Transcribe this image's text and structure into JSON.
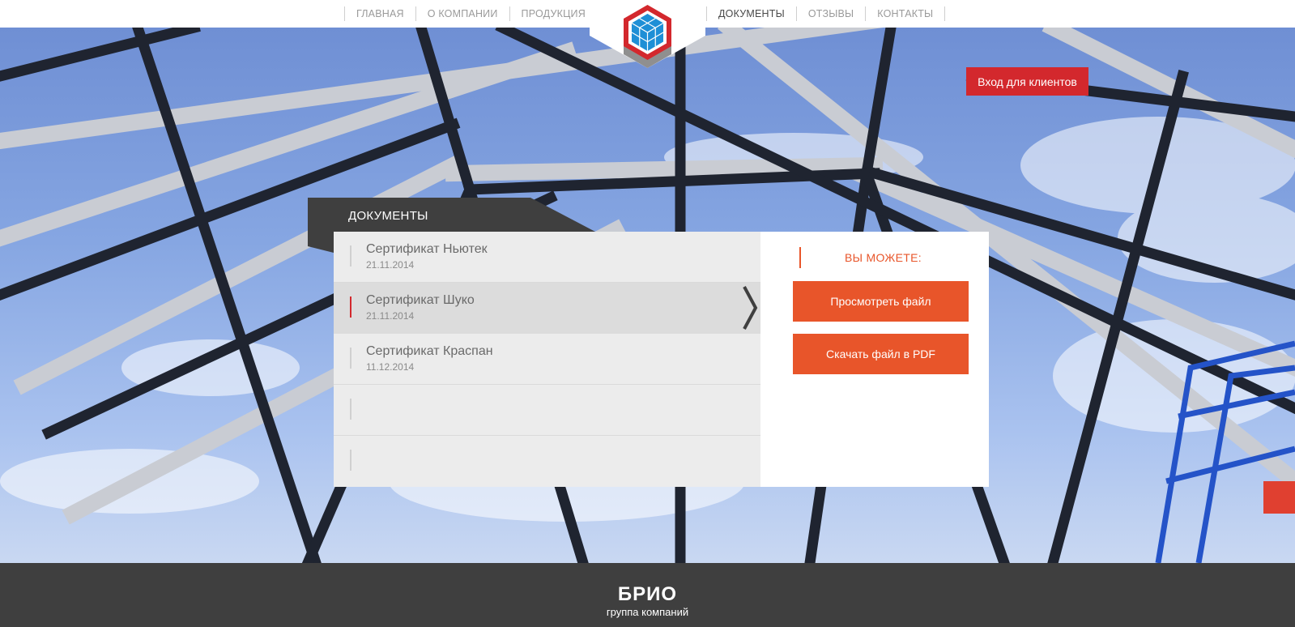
{
  "nav": {
    "left": [
      {
        "label": "ГЛАВНАЯ",
        "active": false
      },
      {
        "label": "О КОМПАНИИ",
        "active": false
      },
      {
        "label": "ПРОДУКЦИЯ",
        "active": false
      }
    ],
    "right": [
      {
        "label": "ДОКУМЕНТЫ",
        "active": true
      },
      {
        "label": "ОТЗЫВЫ",
        "active": false
      },
      {
        "label": "КОНТАКТЫ",
        "active": false
      }
    ]
  },
  "header": {
    "logo_icon": "hexagon-cube-logo-icon",
    "client_login_label": "Вход для клиентов"
  },
  "documents": {
    "tab_title": "ДОКУМЕНТЫ",
    "items": [
      {
        "name": "Сертификат Ньютек",
        "date": "21.11.2014"
      },
      {
        "name": "Сертификат Шуко",
        "date": "21.11.2014"
      },
      {
        "name": "Сертификат Краспан",
        "date": "11.12.2014"
      },
      {
        "name": "",
        "date": ""
      },
      {
        "name": "",
        "date": ""
      }
    ],
    "selected_index": 1
  },
  "actions": {
    "heading": "ВЫ МОЖЕТЕ:",
    "view_label": "Просмотреть файл",
    "download_label": "Скачать файл в PDF"
  },
  "footer": {
    "brand": "БРИО",
    "subtitle": "группа компаний"
  },
  "colors": {
    "accent_red": "#d3282d",
    "accent_orange": "#e8552a",
    "dark_grey": "#3f3f3f"
  }
}
